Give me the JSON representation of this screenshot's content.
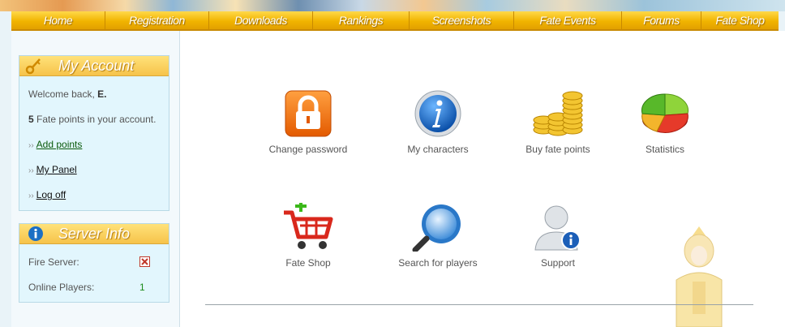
{
  "nav": {
    "items": [
      {
        "label": "Home"
      },
      {
        "label": "Registration"
      },
      {
        "label": "Downloads"
      },
      {
        "label": "Rankings"
      },
      {
        "label": "Screenshots"
      },
      {
        "label": "Fate Events"
      },
      {
        "label": "Forums"
      },
      {
        "label": "Fate Shop"
      }
    ]
  },
  "account": {
    "title": "My Account",
    "welcome_prefix": "Welcome back,",
    "welcome_name": "E.",
    "points_value": "5",
    "points_text": "Fate points in your account.",
    "links": {
      "add_points": "Add points",
      "my_panel": "My Panel",
      "log_off": "Log off"
    }
  },
  "server": {
    "title": "Server Info",
    "fire_server_label": "Fire Server:",
    "online_players_label": "Online Players:",
    "online_players_value": "1"
  },
  "tiles": {
    "change_password": "Change password",
    "my_characters": "My characters",
    "buy_fate_points": "Buy fate points",
    "statistics": "Statistics",
    "fate_shop": "Fate Shop",
    "search_players": "Search for players",
    "support": "Support"
  }
}
